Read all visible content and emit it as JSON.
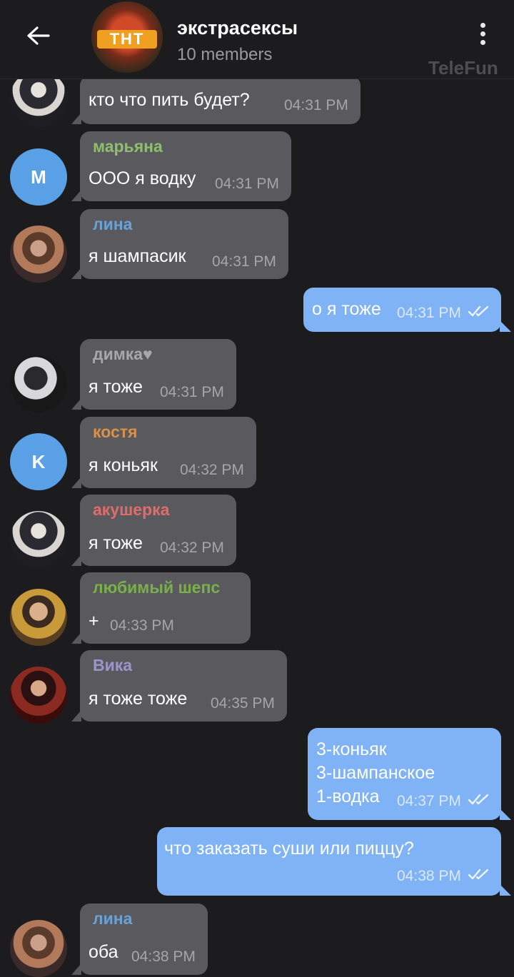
{
  "header": {
    "title": "экстрасексы",
    "subtitle": "10 members",
    "avatar_logo": "ТНТ",
    "watermark": "TeleFun"
  },
  "colors": {
    "background": "#1c1c1e",
    "incoming_bubble": "#5a5a5e",
    "outgoing_bubble": "#7fb3f5",
    "letter_avatar": "#5aa0e6"
  },
  "messages": [
    {
      "text": "кто что пить будет?",
      "time": "04:31 PM"
    },
    {
      "sender": "марьяна",
      "sender_color": "#8cc06a",
      "avatar_letter": "M",
      "text": "ООО я водку",
      "time": "04:31 PM"
    },
    {
      "sender": "лина",
      "sender_color": "#6aa2d6",
      "text": "я шампасик",
      "time": "04:31 PM"
    },
    {
      "text": "о я тоже",
      "time": "04:31 PM",
      "outgoing": true
    },
    {
      "sender": "димка♥",
      "sender_color": "#a8a8ac",
      "text": "я тоже",
      "time": "04:31 PM"
    },
    {
      "sender": "костя",
      "sender_color": "#d9914a",
      "avatar_letter": "K",
      "text": "я коньяк",
      "time": "04:32 PM"
    },
    {
      "sender": "акушерка",
      "sender_color": "#e06b6b",
      "text": "я тоже",
      "time": "04:32 PM"
    },
    {
      "sender": "любимый шепс",
      "sender_color": "#7ab04a",
      "text": "+",
      "time": "04:33 PM"
    },
    {
      "sender": "Вика",
      "sender_color": "#9c95c9",
      "text": "я тоже тоже",
      "time": "04:35 PM"
    },
    {
      "text": "3-коньяк\n3-шампанское\n1-водка",
      "time": "04:37 PM",
      "outgoing": true
    },
    {
      "text": "что заказать суши или пиццу?",
      "time": "04:38 PM",
      "outgoing": true
    },
    {
      "sender": "лина",
      "sender_color": "#6aa2d6",
      "text": "оба",
      "time": "04:38 PM"
    }
  ]
}
